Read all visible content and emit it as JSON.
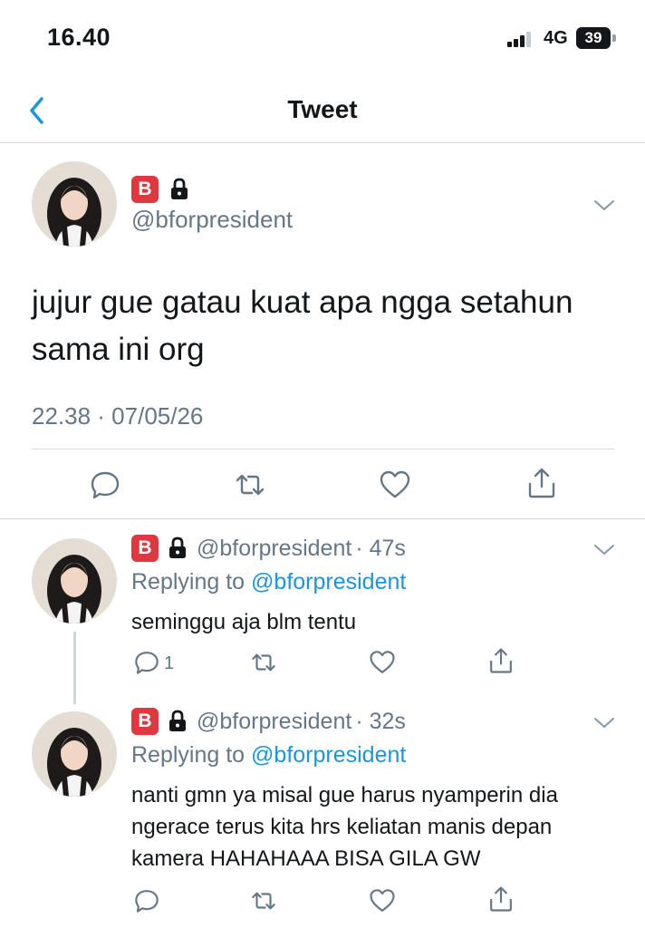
{
  "status_bar": {
    "time": "16.40",
    "network": "4G",
    "battery": "39"
  },
  "nav": {
    "title": "Tweet"
  },
  "main_tweet": {
    "badge": "B",
    "handle": "@bforpresident",
    "text": "jujur gue gatau kuat apa ngga setahun sama ini org",
    "timestamp": "22.38 · 07/05/26"
  },
  "replies": [
    {
      "badge": "B",
      "handle": "@bforpresident",
      "age": "· 47s",
      "replying_prefix": "Replying to",
      "replying_to": "@bforpresident",
      "text": "seminggu aja blm tentu",
      "reply_count": "1"
    },
    {
      "badge": "B",
      "handle": "@bforpresident",
      "age": "· 32s",
      "replying_prefix": "Replying to",
      "replying_to": "@bforpresident",
      "text": "nanti gmn ya misal gue harus nyamperin dia ngerace terus kita hrs keliatan manis depan kamera HAHAHAAA BISA GILA GW",
      "reply_count": ""
    }
  ],
  "colors": {
    "accent": "#1b95e0",
    "secondary_text": "#657786",
    "badge": "#e0383e",
    "divider": "#d4d8db"
  },
  "icons": [
    "back-icon",
    "lock-icon",
    "chevron-down-icon",
    "reply-icon",
    "retweet-icon",
    "like-icon",
    "share-icon"
  ]
}
